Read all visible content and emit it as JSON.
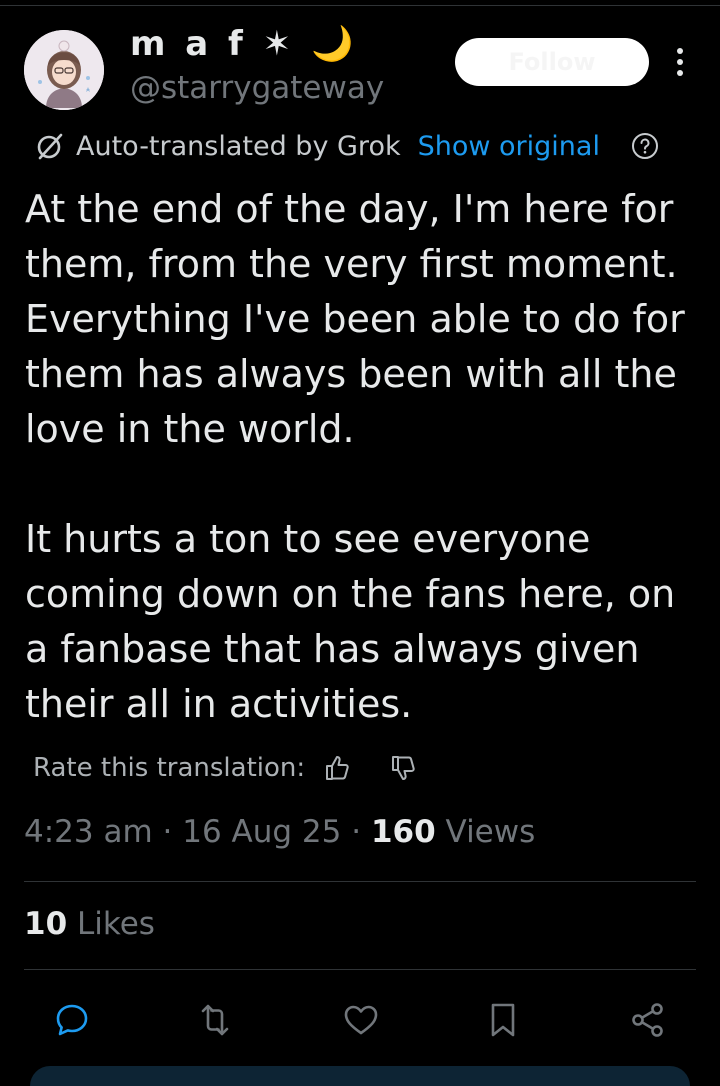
{
  "author": {
    "display_name": "m a f ✶ 🌙",
    "handle": "@starrygateway",
    "follow_label": "Follow"
  },
  "translation": {
    "label": "Auto-translated by Grok",
    "show_original": "Show original",
    "rate_label": "Rate this translation:"
  },
  "tweet": {
    "text": "At the end of the day, I'm here for them, from the very first moment. Everything I've been able to do for them has always been with all the love in the world.\n\nIt hurts a ton to see everyone coming down on the fans here, on a fanbase that has always given their all in activities."
  },
  "meta": {
    "time": "4:23 am",
    "date": "16 Aug 25",
    "views_count": "160",
    "views_label": "Views",
    "separator": "·"
  },
  "likes": {
    "count": "10",
    "label": "Likes"
  },
  "colors": {
    "background": "#000000",
    "text": "#e7e9ea",
    "muted": "#71767b",
    "accent": "#1d9bf0",
    "divider": "#2f3336"
  },
  "icons": [
    "grok-icon",
    "help-icon",
    "thumbs-up-icon",
    "thumbs-down-icon",
    "reply-icon",
    "retweet-icon",
    "like-icon",
    "bookmark-icon",
    "share-icon",
    "more-icon"
  ]
}
